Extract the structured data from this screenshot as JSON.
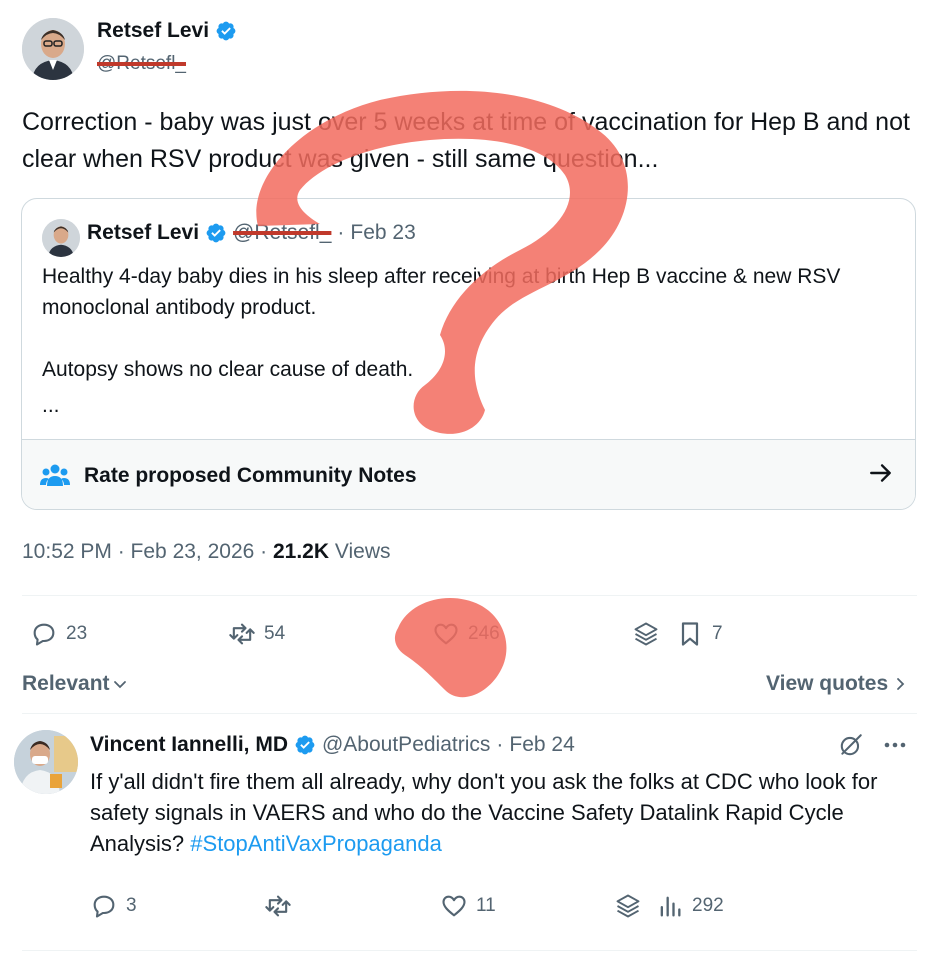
{
  "tweet": {
    "author_name": "Retsef Levi",
    "author_handle": "@Retsefl_",
    "text": "Correction - baby was just over 5 weeks at time of vaccination for Hep B and not clear when RSV product was given - still same question...",
    "timestamp": "10:52 PM · Feb 23, 2026",
    "views_count": "21.2K",
    "views_label": "Views",
    "stats": {
      "replies": "23",
      "reposts": "54",
      "likes": "246",
      "bookmarks": "7"
    }
  },
  "quote": {
    "author_name": "Retsef Levi",
    "author_handle": "@Retsefl_",
    "separator": "·",
    "date": "Feb 23",
    "paragraph1": "Healthy 4-day baby dies in his sleep after receiving at birth Hep B vaccine & new RSV monoclonal antibody product.",
    "paragraph2": "Autopsy shows no clear cause of death.",
    "ellipsis": "...",
    "notes_label": "Rate proposed Community Notes"
  },
  "replies_bar": {
    "sort_label": "Relevant",
    "view_quotes_label": "View quotes"
  },
  "reply": {
    "author_name": "Vincent Iannelli, MD",
    "author_handle": "@AboutPediatrics",
    "separator": "·",
    "date": "Feb 24",
    "text": "If y'all didn't fire them all already, why don't you ask the folks at CDC who look for safety signals in VAERS and who do the Vaccine Safety Datalink Rapid Cycle Analysis?",
    "hashtag": "#StopAntiVaxPropaganda",
    "stats": {
      "replies": "3",
      "likes": "11",
      "views": "292"
    }
  },
  "colors": {
    "verified_blue": "#1d9bf0",
    "text_secondary": "#536471",
    "scribble_red": "#f26b5e"
  },
  "icons": [
    "verified-icon",
    "reply-icon",
    "repost-icon",
    "like-icon",
    "grok-icon",
    "bookmark-icon",
    "community-notes-icon",
    "arrow-right-icon",
    "chevron-down-icon",
    "chevron-right-icon",
    "views-icon",
    "more-icon"
  ]
}
